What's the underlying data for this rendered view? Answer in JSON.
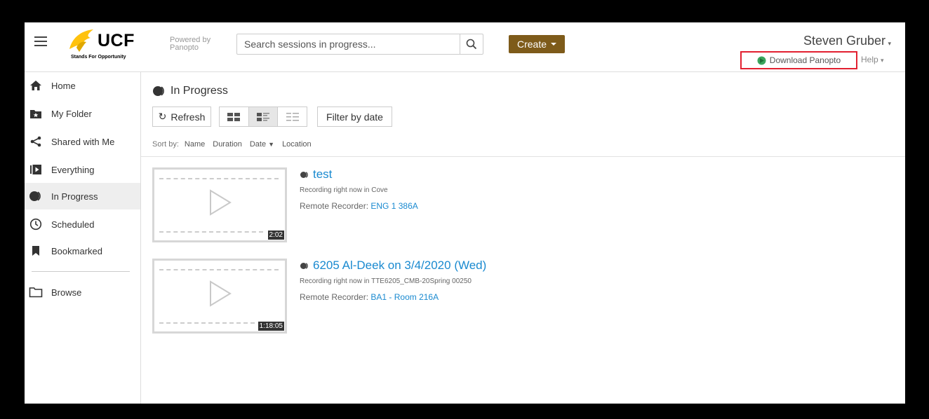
{
  "header": {
    "logo_text": "UCF",
    "logo_tagline": "Stands For Opportunity",
    "powered_by": "Powered by Panopto",
    "search": {
      "placeholder": "Search sessions in progress..."
    },
    "create_label": "Create",
    "user_name": "Steven Gruber",
    "download_label": "Download Panopto",
    "help_label": "Help",
    "colors": {
      "create_bg": "#7e5b1a",
      "highlight_box": "#e22030",
      "link": "#1a8ad0",
      "ucf_gold": "#ffc20e"
    }
  },
  "sidebar": {
    "items": [
      {
        "label": "Home",
        "icon": "home-icon"
      },
      {
        "label": "My Folder",
        "icon": "folder-star-icon"
      },
      {
        "label": "Shared with Me",
        "icon": "share-icon"
      },
      {
        "label": "Everything",
        "icon": "everything-icon"
      },
      {
        "label": "In Progress",
        "icon": "in-progress-icon",
        "active": true
      },
      {
        "label": "Scheduled",
        "icon": "clock-icon"
      },
      {
        "label": "Bookmarked",
        "icon": "bookmark-icon"
      },
      {
        "label": "Browse",
        "icon": "folder-outline-icon"
      }
    ]
  },
  "main": {
    "title": "In Progress",
    "toolbar": {
      "refresh_label": "Refresh",
      "filter_label": "Filter by date",
      "view_modes": [
        "grid",
        "detail",
        "list"
      ],
      "active_view": "detail"
    },
    "sort": {
      "label": "Sort by:",
      "options": [
        "Name",
        "Duration",
        "Date",
        "Location"
      ],
      "active": "Date"
    },
    "sessions": [
      {
        "title": "test",
        "status": "Recording right now in Cove",
        "recorder_label": "Remote Recorder:",
        "recorder_name": "ENG 1 386A",
        "duration": "2:02"
      },
      {
        "title": "6205 Al-Deek on 3/4/2020 (Wed)",
        "status": "Recording right now in TTE6205_CMB-20Spring 00250",
        "recorder_label": "Remote Recorder:",
        "recorder_name": "BA1 - Room 216A",
        "duration": "1:18:05"
      }
    ]
  }
}
